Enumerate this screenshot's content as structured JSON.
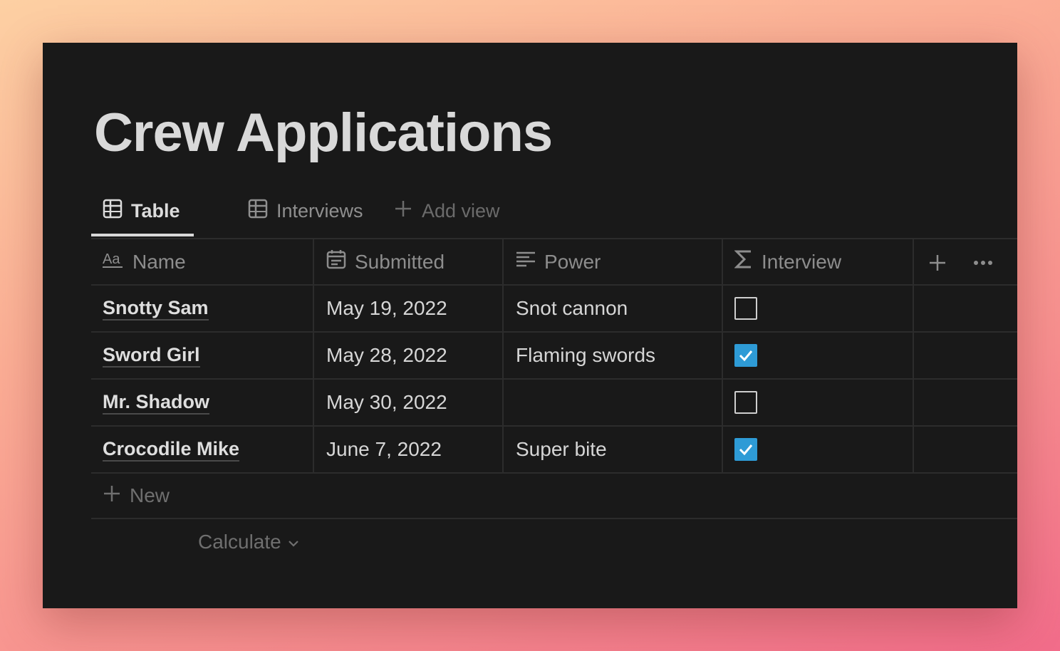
{
  "page": {
    "title": "Crew Applications"
  },
  "views": {
    "tabs": [
      {
        "label": "Table",
        "icon": "table-icon",
        "active": true
      },
      {
        "label": "Interviews",
        "icon": "table-icon",
        "active": false
      }
    ],
    "add_view_label": "Add view"
  },
  "table": {
    "columns": [
      {
        "label": "Name",
        "icon": "text-type-icon"
      },
      {
        "label": "Submitted",
        "icon": "calendar-icon"
      },
      {
        "label": "Power",
        "icon": "text-lines-icon"
      },
      {
        "label": "Interview",
        "icon": "sigma-icon"
      }
    ],
    "rows": [
      {
        "name": "Snotty Sam",
        "submitted": "May 19, 2022",
        "power": "Snot cannon",
        "interview": false
      },
      {
        "name": "Sword Girl",
        "submitted": "May 28, 2022",
        "power": "Flaming swords",
        "interview": true
      },
      {
        "name": "Mr. Shadow",
        "submitted": "May 30, 2022",
        "power": "",
        "interview": false
      },
      {
        "name": "Crocodile Mike",
        "submitted": "June 7, 2022",
        "power": "Super bite",
        "interview": true
      }
    ],
    "new_label": "New",
    "calculate_label": "Calculate"
  },
  "colors": {
    "background": "#191919",
    "checkbox_checked": "#2e9bd6",
    "text_primary": "#d9d9d9",
    "text_muted": "#8d8d8d"
  }
}
